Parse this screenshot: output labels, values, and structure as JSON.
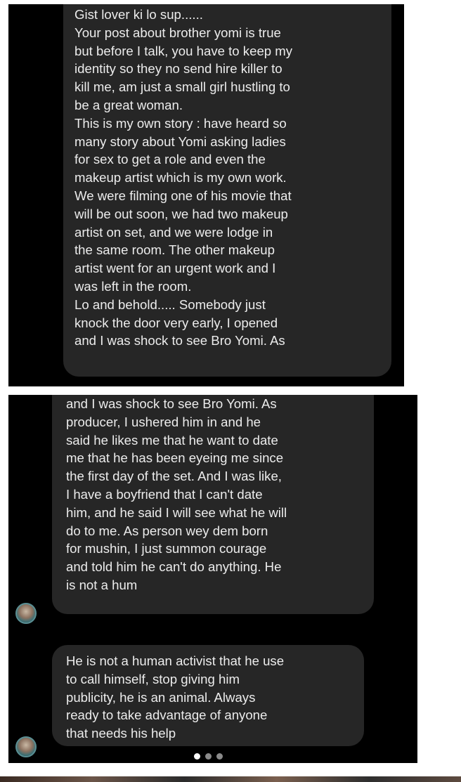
{
  "screen1": {
    "message": {
      "lines": [
        "Gist lover ki lo sup......",
        "Your post about brother yomi is true",
        "but before I talk, you have to keep my",
        "identity so they no send hire killer to",
        "kill me, am just a small girl hustling to",
        "be a great woman.",
        "This is my own story : have heard so",
        "many story about Yomi asking ladies",
        "for sex to get a role and even the",
        "makeup artist which is my own work.",
        "We were filming one of his movie that",
        "will be out soon, we had two makeup",
        "artist on set, and we were lodge in",
        "the same room. The other makeup",
        "artist went for an urgent work and I",
        "was left in the room.",
        "Lo and behold..... Somebody just",
        "knock the door very early, I opened",
        "and I was shock to see Bro Yomi. As"
      ]
    }
  },
  "screen2": {
    "message_1": {
      "lines": [
        "and I was shock to see Bro Yomi. As",
        "producer, I ushered him in and he",
        "said he likes me that he want to date",
        "me that he has been eyeing me since",
        "the first day of the set. And I was like,",
        "I have a boyfriend that I can't date",
        "him, and he said I will see what he will",
        "do to me. As person wey dem born",
        "for mushin, I just summon courage",
        "and told him he can't do anything. He",
        "is not a hum"
      ]
    },
    "message_2": {
      "lines": [
        "He is not a human activist that he use",
        "to call himself, stop giving him",
        "publicity, he is an animal. Always",
        "ready to take advantage of anyone",
        "that needs his help"
      ]
    },
    "pagination": {
      "total": 3,
      "active": 1
    }
  },
  "colors": {
    "panel_background": "#000000",
    "bubble_background": "#262626",
    "message_text": "#ececec",
    "page_background": "#ffffff"
  }
}
